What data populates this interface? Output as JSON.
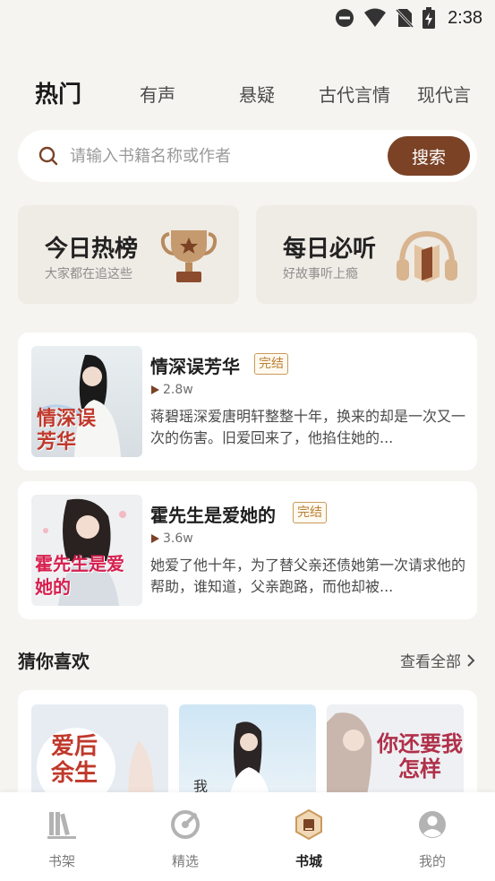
{
  "status_bar": {
    "time": "2:38",
    "icons": [
      "do-not-disturb-icon",
      "wifi-icon",
      "no-sim-icon",
      "battery-charging-icon"
    ]
  },
  "tabs": [
    {
      "label": "热门",
      "active": true
    },
    {
      "label": "有声",
      "active": false
    },
    {
      "label": "悬疑",
      "active": false
    },
    {
      "label": "古代言情",
      "active": false
    },
    {
      "label": "现代言",
      "active": false
    }
  ],
  "search": {
    "placeholder": "请输入书籍名称或作者",
    "button_label": "搜索"
  },
  "features": [
    {
      "title": "今日热榜",
      "subtitle": "大家都在追这些",
      "icon": "trophy-icon"
    },
    {
      "title": "每日必听",
      "subtitle": "好故事听上瘾",
      "icon": "headphones-book-icon"
    }
  ],
  "books": [
    {
      "title": "情深误芳华",
      "badge": "完结",
      "plays": "2.8w",
      "description": "蒋碧瑶深爱唐明轩整整十年，换来的却是一次又一次的伤害。旧爱回来了，他掐住她的...",
      "cover_text": "情深误芳华"
    },
    {
      "title": "霍先生是爱她的",
      "badge": "完结",
      "plays": "3.6w",
      "description": "她爱了他十年，为了替父亲还债她第一次请求他的帮助，谁知道，父亲跑路，而他却被...",
      "cover_text": "霍先生是爱她的"
    }
  ],
  "guess": {
    "title": "猜你喜欢",
    "see_all": "查看全部",
    "covers": [
      {
        "text": "爱后余生"
      },
      {
        "text": "我"
      },
      {
        "text": "你还要我怎样"
      }
    ]
  },
  "bottom_nav": [
    {
      "label": "书架",
      "icon": "bookshelf-icon",
      "active": false
    },
    {
      "label": "精选",
      "icon": "featured-icon",
      "active": false
    },
    {
      "label": "书城",
      "icon": "bookstore-icon",
      "active": true
    },
    {
      "label": "我的",
      "icon": "profile-icon",
      "active": false
    }
  ],
  "colors": {
    "background": "#f6f4f0",
    "accent": "#7b4226",
    "badge": "#b97f34",
    "card_feature": "#efebe5"
  }
}
